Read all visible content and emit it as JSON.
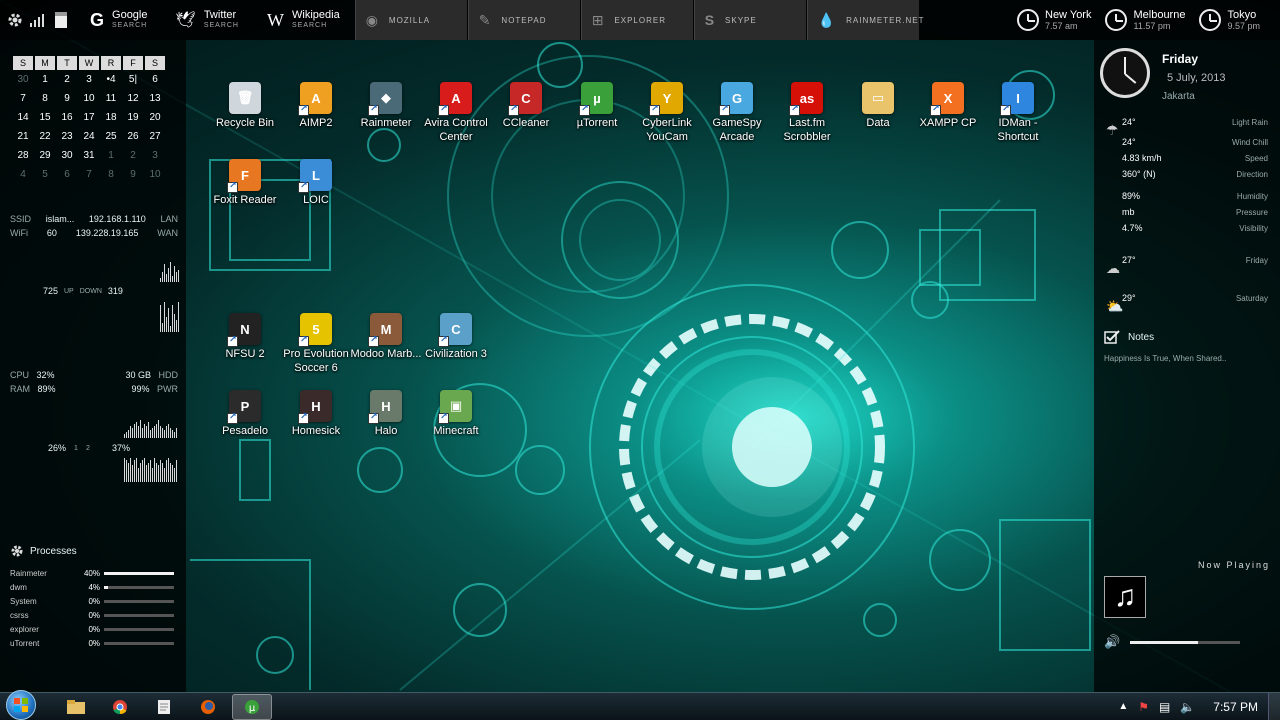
{
  "topbar": {
    "searches": [
      {
        "title": "Google",
        "sub": "SEARCH",
        "icon": "google-icon"
      },
      {
        "title": "Twitter",
        "sub": "SEARCH",
        "icon": "twitter-icon"
      },
      {
        "title": "Wikipedia",
        "sub": "SEARCH",
        "icon": "wikipedia-icon"
      }
    ],
    "launchers": [
      "MOZILLA",
      "NOTEPAD",
      "EXPLORER",
      "SKYPE",
      "RAINMETER.NET"
    ],
    "clocks": [
      {
        "city": "New York",
        "time": "7.57 am"
      },
      {
        "city": "Melbourne",
        "time": "11.57 pm"
      },
      {
        "city": "Tokyo",
        "time": "9.57 pm"
      }
    ]
  },
  "calendar": {
    "headers": [
      "S",
      "M",
      "T",
      "W",
      "R",
      "F",
      "S"
    ],
    "weeks": [
      [
        "30",
        "1",
        "2",
        "3",
        "•4",
        "5|",
        "6"
      ],
      [
        "7",
        "8",
        "9",
        "10",
        "11",
        "12",
        "13"
      ],
      [
        "14",
        "15",
        "16",
        "17",
        "18",
        "19",
        "20"
      ],
      [
        "21",
        "22",
        "23",
        "24",
        "25",
        "26",
        "27"
      ],
      [
        "28",
        "29",
        "30",
        "31",
        "1",
        "2",
        "3"
      ],
      [
        "4",
        "5",
        "6",
        "7",
        "8",
        "9",
        "10"
      ]
    ],
    "dim_cells": [
      [
        0,
        0
      ],
      [
        4,
        4
      ],
      [
        4,
        5
      ],
      [
        4,
        6
      ],
      [
        5,
        0
      ],
      [
        5,
        1
      ],
      [
        5,
        2
      ],
      [
        5,
        3
      ],
      [
        5,
        4
      ],
      [
        5,
        5
      ],
      [
        5,
        6
      ]
    ]
  },
  "network": {
    "ssid_label": "SSID",
    "ssid": "islam...",
    "lan_ip": "192.168.1.110",
    "lan_label": "LAN",
    "wifi_label": "WiFi",
    "wifi": "60",
    "wan_ip": "139.228.19.165",
    "wan_label": "WAN",
    "up_value": "725",
    "up_label": "UP",
    "down_label": "DOWN",
    "down_value": "319"
  },
  "system": {
    "cpu_label": "CPU",
    "cpu": "32%",
    "hdd_value": "30 GB",
    "hdd_label": "HDD",
    "ram_label": "RAM",
    "ram": "89%",
    "pwr_value": "99%",
    "pwr_label": "PWR",
    "core1": "26%",
    "core1_n": "1",
    "core2_n": "2",
    "core2": "37%"
  },
  "processes": {
    "title": "Processes",
    "items": [
      {
        "name": "Rainmeter",
        "value": "40%",
        "level": 1.0
      },
      {
        "name": "dwm",
        "value": "4%",
        "level": 0.05
      },
      {
        "name": "System",
        "value": "0%",
        "level": 0
      },
      {
        "name": "csrss",
        "value": "0%",
        "level": 0
      },
      {
        "name": "explorer",
        "value": "0%",
        "level": 0
      },
      {
        "name": "uTorrent",
        "value": "0%",
        "level": 0
      }
    ]
  },
  "datetime": {
    "day": "Friday",
    "date": "5 July, 2013",
    "place": "Jakarta"
  },
  "weather": {
    "rows": [
      {
        "value": "24°",
        "label": "Light Rain"
      },
      {
        "value": "24°",
        "label": "Wind Chill"
      },
      {
        "value": "4.83 km/h",
        "label": "Speed"
      },
      {
        "value": "360° (N)",
        "label": "Direction"
      },
      {
        "value": "89%",
        "label": "Humidity"
      },
      {
        "value": "mb",
        "label": "Pressure"
      },
      {
        "value": "4.7%",
        "label": "Visibility"
      },
      {
        "value": "27°",
        "label": "Friday"
      },
      {
        "value": "29°",
        "label": "Saturday"
      }
    ]
  },
  "notes": {
    "title": "Notes",
    "text": "Happiness Is True, When Shared.."
  },
  "nowplaying": {
    "label": "Now Playing",
    "volume_level": 0.62
  },
  "desktop_icons": [
    {
      "label": "Recycle Bin",
      "color": "#cfd6dc",
      "glyph": "🗑"
    },
    {
      "label": "AIMP2",
      "color": "#f0a020",
      "glyph": "A"
    },
    {
      "label": "Rainmeter",
      "color": "#4a6a78",
      "glyph": "◆"
    },
    {
      "label": "Avira Control Center",
      "color": "#d81c1c",
      "glyph": "A"
    },
    {
      "label": "CCleaner",
      "color": "#c62828",
      "glyph": "C"
    },
    {
      "label": "µTorrent",
      "color": "#3aa13a",
      "glyph": "µ"
    },
    {
      "label": "CyberLink YouCam",
      "color": "#e0a800",
      "glyph": "Y"
    },
    {
      "label": "GameSpy Arcade",
      "color": "#4aa8e0",
      "glyph": "G"
    },
    {
      "label": "Last.fm Scrobbler",
      "color": "#d51007",
      "glyph": "as"
    },
    {
      "label": "Data",
      "color": "#e9c46a",
      "glyph": "▭"
    },
    {
      "label": "XAMPP CP",
      "color": "#f37021",
      "glyph": "X"
    },
    {
      "label": "IDMan - Shortcut",
      "color": "#2e86de",
      "glyph": "I"
    },
    {
      "label": "Foxit Reader",
      "color": "#e87722",
      "glyph": "F"
    },
    {
      "label": "LOIC",
      "color": "#3c8dd8",
      "glyph": "L"
    },
    {
      "label": "NFSU 2",
      "color": "#222",
      "glyph": "N"
    },
    {
      "label": "Pro Evolution Soccer 6",
      "color": "#e6c300",
      "glyph": "5"
    },
    {
      "label": "Modoo Marb...",
      "color": "#8a5a3a",
      "glyph": "M"
    },
    {
      "label": "Civilization 3",
      "color": "#5aa0c8",
      "glyph": "C"
    },
    {
      "label": "Pesadelo",
      "color": "#2b2b2b",
      "glyph": "P"
    },
    {
      "label": "Homesick",
      "color": "#3a2a2a",
      "glyph": "H"
    },
    {
      "label": "Halo",
      "color": "#6a7a6a",
      "glyph": "H"
    },
    {
      "label": "Minecraft",
      "color": "#6aa84f",
      "glyph": "▣"
    }
  ],
  "taskbar": {
    "apps": [
      "explorer",
      "chrome",
      "notepad",
      "firefox",
      "utorrent"
    ],
    "active": "utorrent",
    "clock": "7:57 PM"
  }
}
